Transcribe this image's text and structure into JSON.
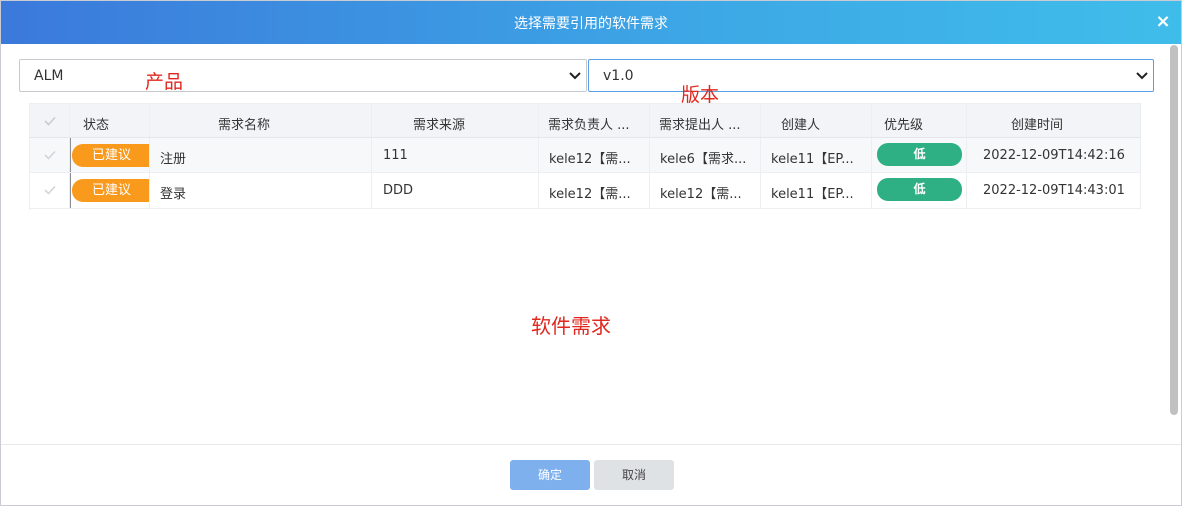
{
  "dialog": {
    "title": "选择需要引用的软件需求",
    "close_glyph": "×"
  },
  "filters": {
    "product": {
      "value": "ALM",
      "annotation": "产品"
    },
    "version": {
      "value": "v1.0",
      "annotation": "版本"
    }
  },
  "table": {
    "columns": [
      "状态",
      "需求名称",
      "需求来源",
      "需求负责人 ...",
      "需求提出人 ...",
      "创建人",
      "优先级",
      "创建时间"
    ],
    "rows": [
      {
        "status": "已建议",
        "name": "注册",
        "source": "111",
        "owner": "kele12【需...",
        "proposer": "kele6【需求...",
        "creator": "kele11【EP...",
        "priority": "低",
        "created": "2022-12-09T14:42:16"
      },
      {
        "status": "已建议",
        "name": "登录",
        "source": "DDD",
        "owner": "kele12【需...",
        "proposer": "kele12【需...",
        "creator": "kele11【EP...",
        "priority": "低",
        "created": "2022-12-09T14:43:01"
      }
    ]
  },
  "center_annotation": "软件需求",
  "footer": {
    "ok_label": "确定",
    "cancel_label": "取消"
  },
  "colors": {
    "title_gradient_start": "#3b79db",
    "title_gradient_end": "#3fbdea",
    "status_orange": "#f99a1c",
    "priority_green": "#2fb084",
    "annotation_red": "#e0281f",
    "ok_button": "#7eb0ee"
  },
  "icons": {
    "close": "close-icon",
    "dropdown": "chevron-down-icon",
    "checkbox": "check-icon"
  }
}
